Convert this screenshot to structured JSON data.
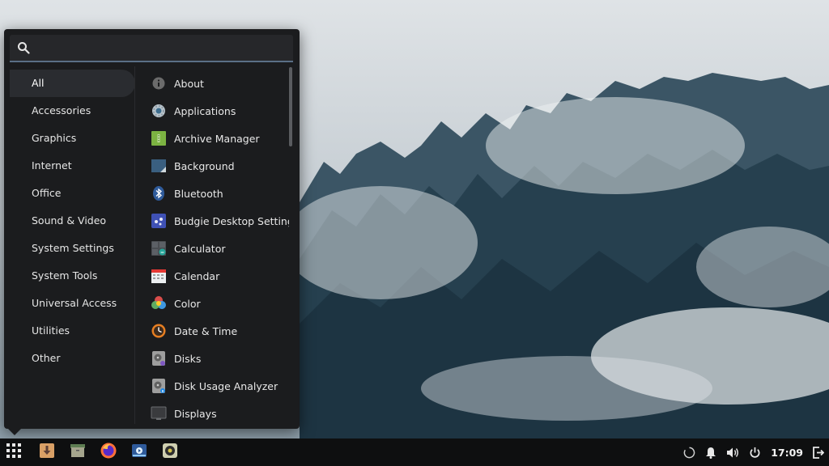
{
  "search": {
    "placeholder": "",
    "value": ""
  },
  "categories": [
    {
      "label": "All",
      "active": true
    },
    {
      "label": "Accessories"
    },
    {
      "label": "Graphics"
    },
    {
      "label": "Internet"
    },
    {
      "label": "Office"
    },
    {
      "label": "Sound & Video"
    },
    {
      "label": "System Settings"
    },
    {
      "label": "System Tools"
    },
    {
      "label": "Universal Access"
    },
    {
      "label": "Utilities"
    },
    {
      "label": "Other"
    }
  ],
  "apps": [
    {
      "label": "About",
      "icon": "info-icon"
    },
    {
      "label": "Applications",
      "icon": "gear-icon"
    },
    {
      "label": "Archive Manager",
      "icon": "archive-icon"
    },
    {
      "label": "Background",
      "icon": "background-icon"
    },
    {
      "label": "Bluetooth",
      "icon": "bluetooth-icon"
    },
    {
      "label": "Budgie Desktop Settings",
      "icon": "budgie-settings-icon"
    },
    {
      "label": "Calculator",
      "icon": "calculator-icon"
    },
    {
      "label": "Calendar",
      "icon": "calendar-icon"
    },
    {
      "label": "Color",
      "icon": "color-icon"
    },
    {
      "label": "Date & Time",
      "icon": "clock-icon"
    },
    {
      "label": "Disks",
      "icon": "disks-icon"
    },
    {
      "label": "Disk Usage Analyzer",
      "icon": "disk-usage-icon"
    },
    {
      "label": "Displays",
      "icon": "display-icon"
    }
  ],
  "taskbar": {
    "launchers": [
      "downloader-icon",
      "files-icon",
      "firefox-icon",
      "screenshot-app-icon",
      "rhythmbox-icon"
    ]
  },
  "tray": {
    "time": "17:09",
    "icons": [
      "loading-icon",
      "bell-icon",
      "volume-icon",
      "power-icon",
      "logout-icon"
    ]
  },
  "colors": {
    "menu_bg": "#1b1c1e",
    "panel_bg": "#0e0f10",
    "accent": "#5a6f86"
  }
}
